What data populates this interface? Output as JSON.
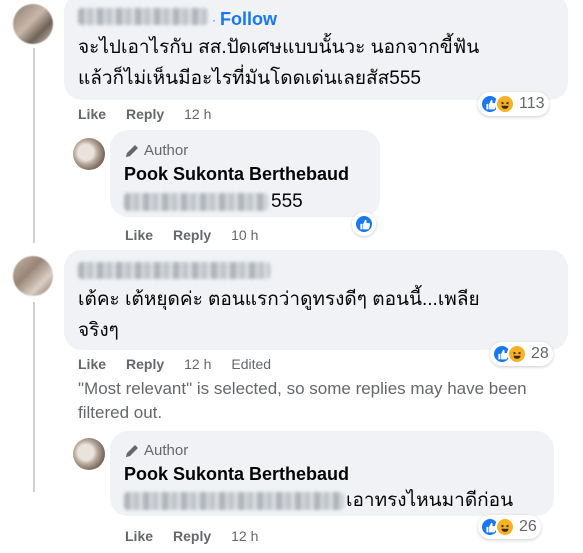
{
  "comments": [
    {
      "follow": "Follow",
      "text_line1": "จะไปเอาไรกับ สส.ปัดเศษแบบนั้นวะ นอกจากขี้ฟัน",
      "text_line2": "แล้วก็ไม่เห็นมีอะไรที่มันโดดเด่นเลยสัส555",
      "like": "Like",
      "reply": "Reply",
      "time": "12 h",
      "reaction_count": "113"
    },
    {
      "author_badge": "Author",
      "name": "Pook Sukonta Berthebaud",
      "text_suffix": "555",
      "like": "Like",
      "reply": "Reply",
      "time": "10 h"
    },
    {
      "text_line1": "เต้คะ เต้หยุดค่ะ ตอนแรกว่าดูทรงดีๆ ตอนนี้...เพลีย",
      "text_line2": "จริงๆ",
      "like": "Like",
      "reply": "Reply",
      "time": "12 h",
      "edited": "Edited",
      "reaction_count": "28"
    },
    {
      "author_badge": "Author",
      "name": "Pook Sukonta Berthebaud",
      "text_suffix": "เอาทรงไหนมาดีก่อน",
      "like": "Like",
      "reply": "Reply",
      "time": "12 h",
      "reaction_count": "26"
    }
  ],
  "filter_note_line1": "\"Most relevant\" is selected, so some replies may have been",
  "filter_note_line2": "filtered out.",
  "icons": {
    "pencil": "pencil-icon",
    "like": "like-reaction-icon",
    "haha": "haha-reaction-icon"
  },
  "colors": {
    "accent": "#1877f2",
    "bubble": "#f0f2f5",
    "meta": "#65676b",
    "haha": "#f7b125"
  }
}
